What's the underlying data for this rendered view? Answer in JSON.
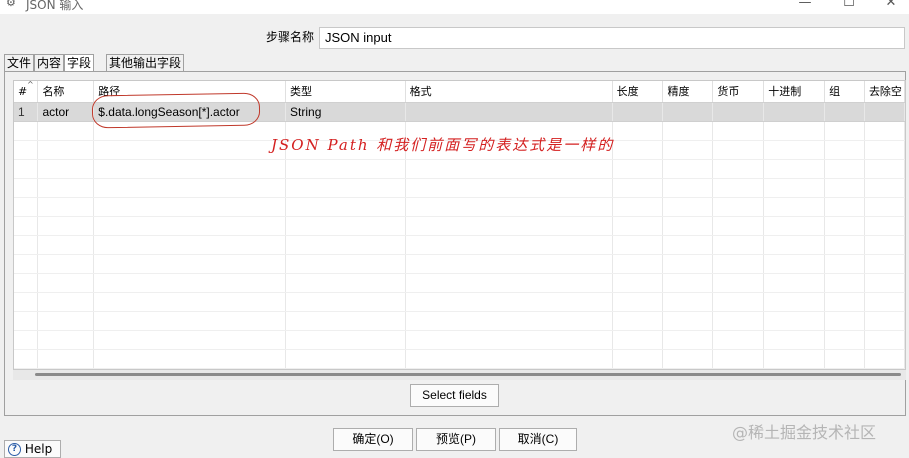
{
  "window": {
    "title": "JSON 输入",
    "title_icon": "json-step-icon",
    "controls": {
      "minimize": "—",
      "maximize": "☐",
      "close": "✕"
    }
  },
  "step_name": {
    "label": "步骤名称",
    "value": "JSON input"
  },
  "tabs": [
    {
      "label": "文件",
      "active": false
    },
    {
      "label": "内容",
      "active": false
    },
    {
      "label": "字段",
      "active": true
    },
    {
      "label": "其他输出字段",
      "active": false
    }
  ],
  "fields_table": {
    "columns": [
      "#",
      "名称",
      "路径",
      "类型",
      "格式",
      "长度",
      "精度",
      "货币",
      "十进制",
      "组",
      "去除空"
    ],
    "rows": [
      {
        "num": "1",
        "name": "actor",
        "path": "$.data.longSeason[*].actor",
        "type": "String",
        "format": "",
        "length": "",
        "precision": "",
        "currency": "",
        "decimal": "",
        "group": "",
        "trim": ""
      }
    ]
  },
  "annotation": {
    "text": "JSON Path 和我们前面写的表达式是一样的",
    "color": "#d42020"
  },
  "buttons": {
    "select_fields": "Select fields",
    "ok": "确定(O)",
    "preview": "预览(P)",
    "cancel": "取消(C)",
    "help": "Help"
  },
  "watermark": "@稀土掘金技术社区"
}
